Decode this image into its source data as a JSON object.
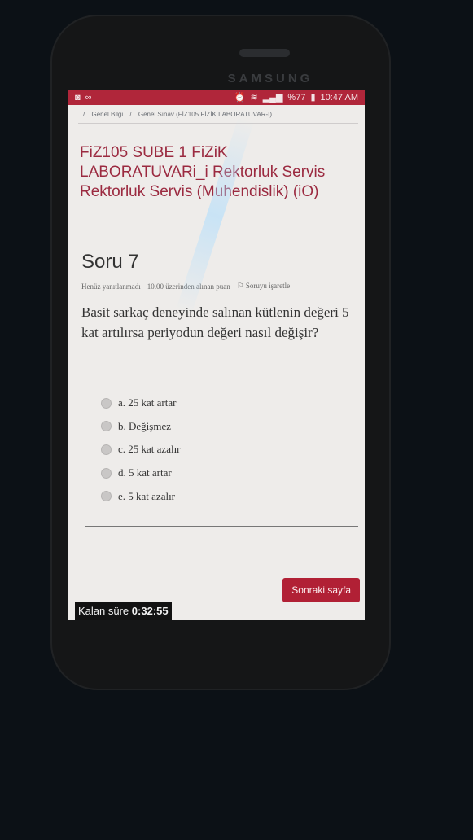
{
  "device": {
    "brand": "SAMSUNG"
  },
  "statusbar": {
    "battery": "%77",
    "time": "10:47 AM"
  },
  "breadcrumb": {
    "items": [
      "/",
      "Genel Bilgi",
      "/",
      "Genel Sınav (FİZ105 FİZİK LABORATUVAR-I)"
    ]
  },
  "course_title": "FiZ105 SUBE 1 FiZiK LABORATUVARi_i Rektorluk Servis Rektorluk Servis (Muhendislik) (iO)",
  "question": {
    "title": "Soru 7",
    "status": "Henüz yanıtlanmadı",
    "points": "10.00 üzerinden alınan puan",
    "flag_label": "Soruyu işaretle",
    "text": "Basit sarkaç deneyinde salınan kütlenin değeri 5 kat artılırsa periyodun değeri nasıl değişir?",
    "answers": [
      "a. 25 kat artar",
      "b. Değişmez",
      "c. 25 kat azalır",
      "d. 5 kat artar",
      "e. 5 kat azalır"
    ]
  },
  "next_button": "Sonraki sayfa",
  "timer": {
    "label": "Kalan süre",
    "value": "0:32:55"
  },
  "colors": {
    "accent": "#b0263a",
    "title": "#9b2a40"
  }
}
